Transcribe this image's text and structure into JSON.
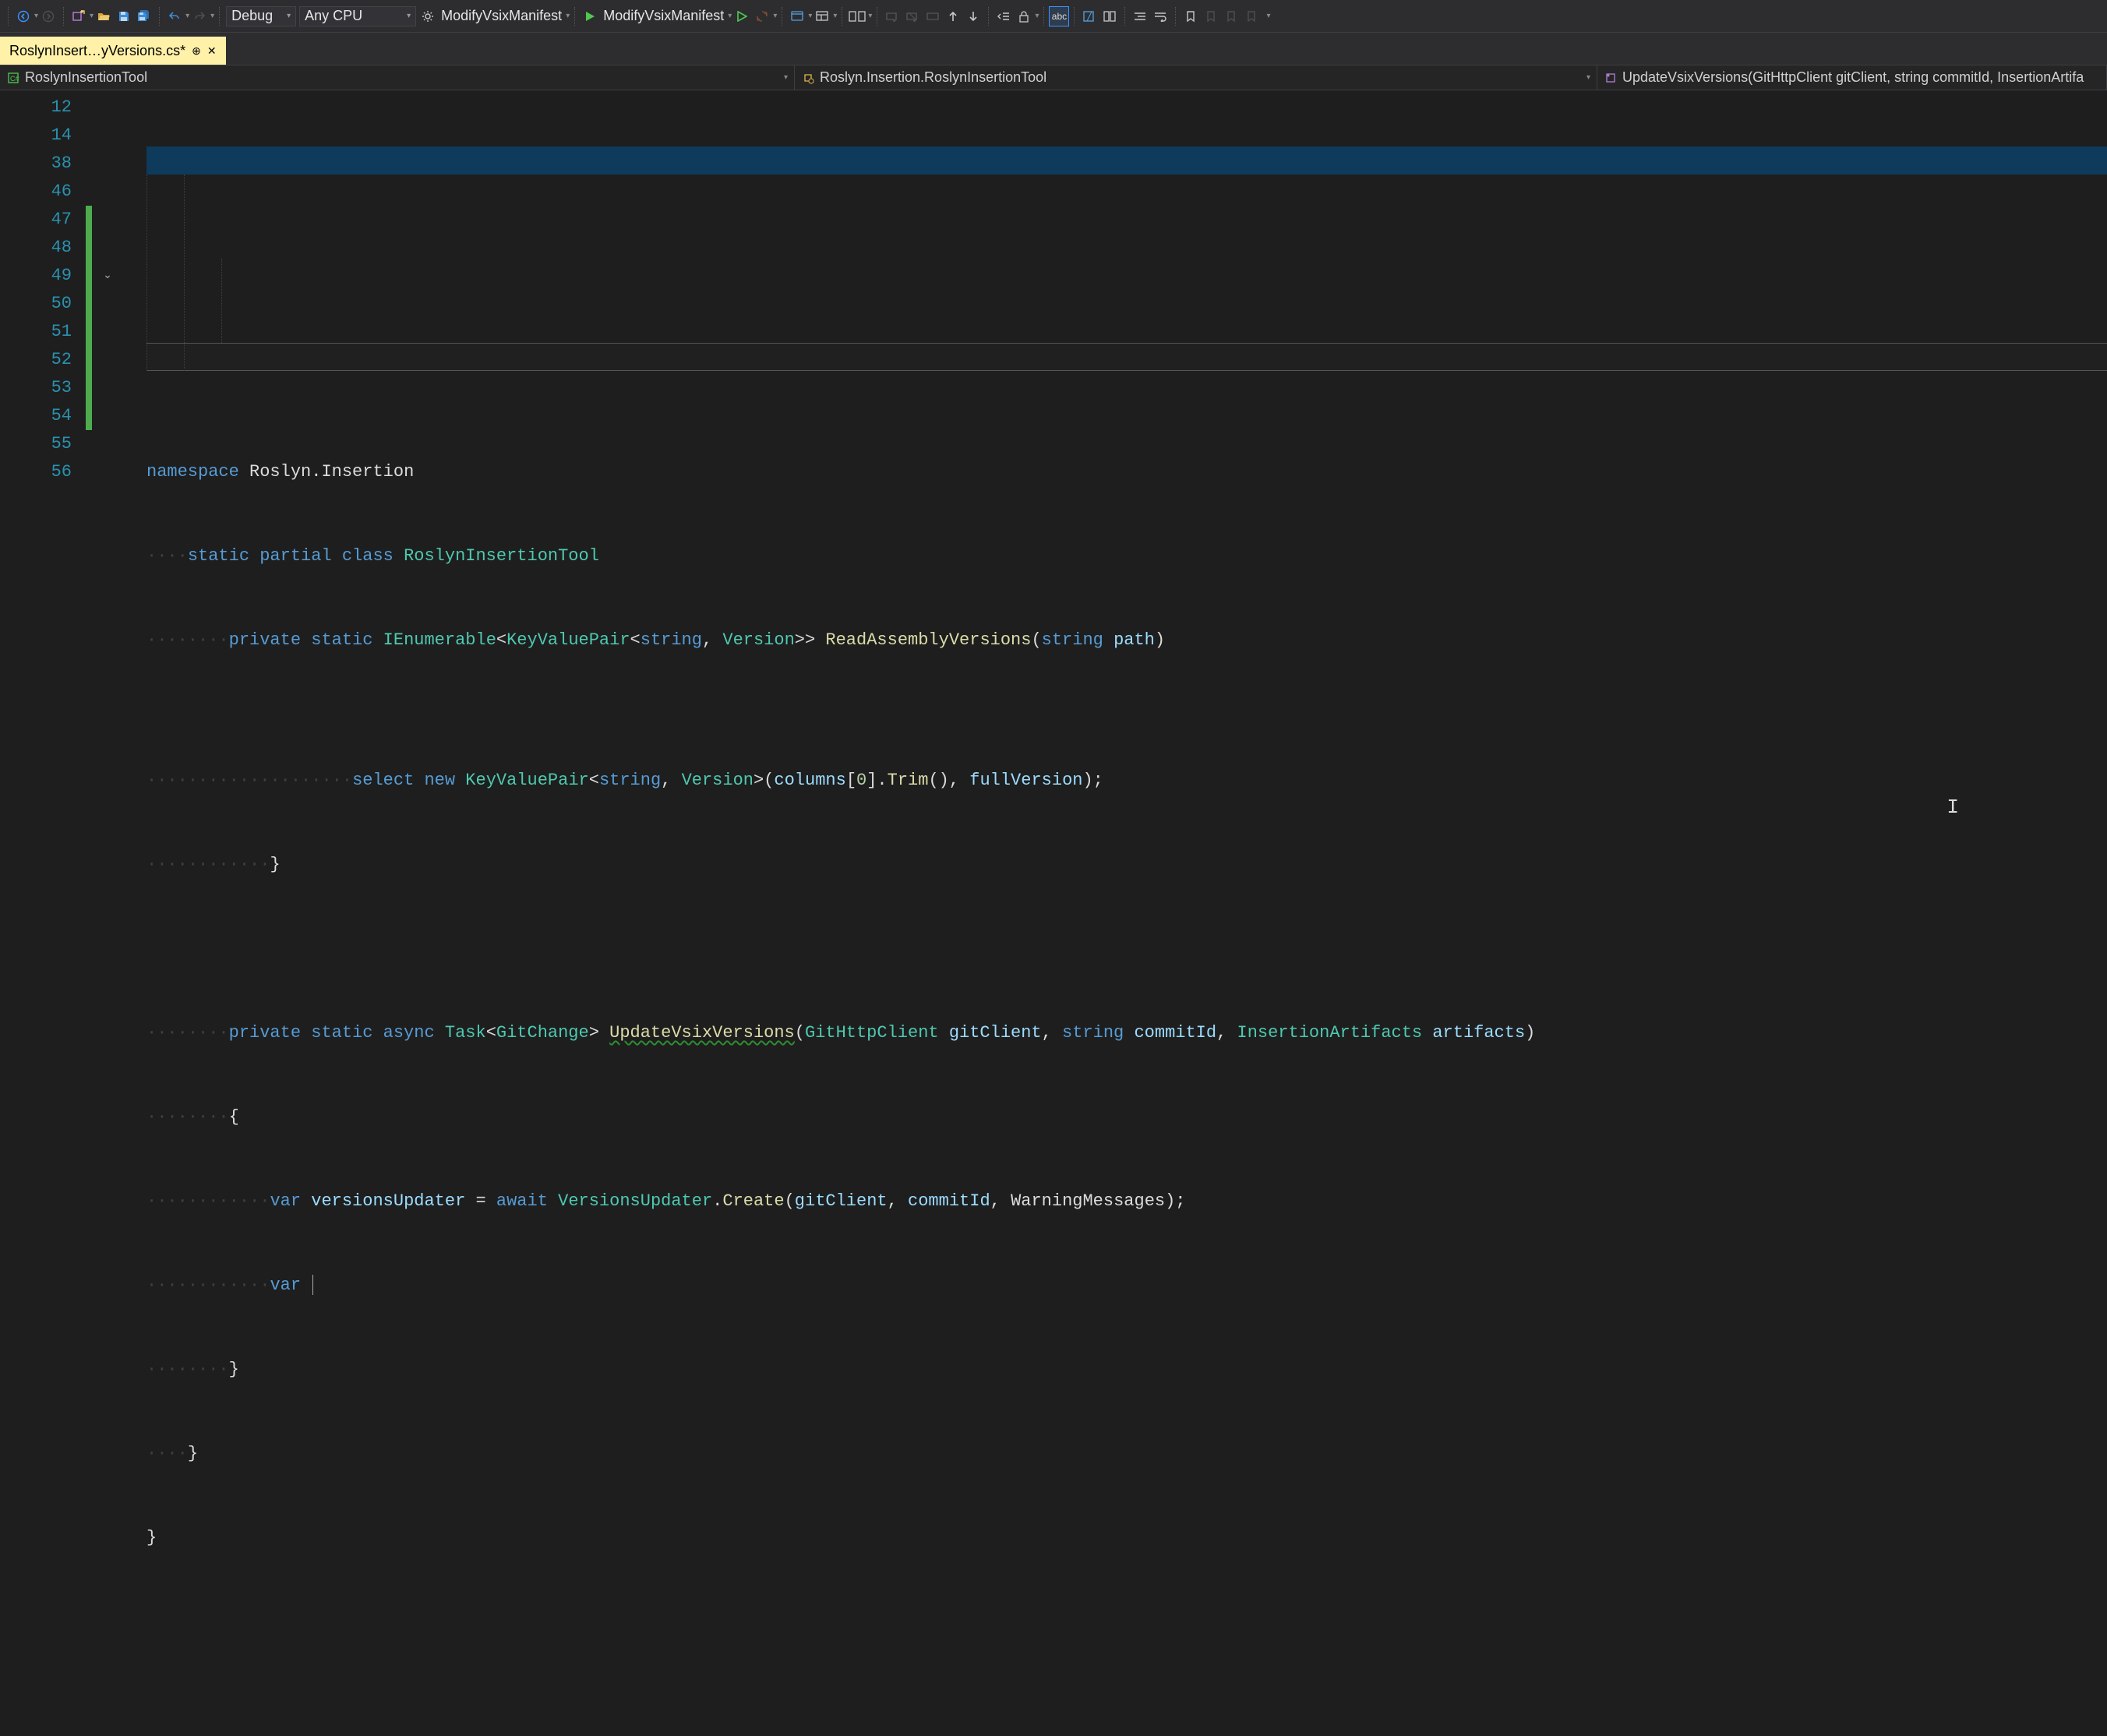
{
  "toolbar": {
    "config_label": "Debug",
    "platform_label": "Any CPU",
    "startup_label1": "ModifyVsixManifest",
    "startup_label2": "ModifyVsixManifest"
  },
  "tab": {
    "name": "RoslynInsert…yVersions.cs*"
  },
  "navbar": {
    "project": "RoslynInsertionTool",
    "type": "Roslyn.Insertion.RoslynInsertionTool",
    "member": "UpdateVsixVersions(GitHttpClient gitClient, string commitId, InsertionArtifa"
  },
  "line_numbers": [
    "12",
    "14",
    "38",
    "46",
    "47",
    "48",
    "49",
    "50",
    "51",
    "52",
    "53",
    "54",
    "55",
    "56"
  ],
  "code": {
    "l12": {
      "ns": "namespace",
      "name": "Roslyn.Insertion"
    },
    "l14": {
      "kws": "static partial class",
      "name": "RoslynInsertionTool"
    },
    "l38": {
      "mods": "private static",
      "ret1": "IEnumerable",
      "ret2": "KeyValuePair",
      "ta1": "string",
      "ta2": "Version",
      "mname": "ReadAssemblyVersions",
      "p1t": "string",
      "p1n": "path"
    },
    "l46": {
      "sel": "select",
      "nw": "new",
      "kvp": "KeyValuePair",
      "ta1": "string",
      "ta2": "Version",
      "col": "columns",
      "idx": "0",
      "trim": "Trim",
      "fv": "fullVersion"
    },
    "l47": {
      "brace": "}"
    },
    "l49": {
      "mods": "private static async",
      "ret1": "Task",
      "ret2": "GitChange",
      "mname": "UpdateVsixVersions",
      "p1t": "GitHttpClient",
      "p1n": "gitClient",
      "p2t": "string",
      "p2n": "commitId",
      "p3t": "InsertionArtifacts",
      "p3n": "artifacts"
    },
    "l50": {
      "brace": "{"
    },
    "l51": {
      "var": "var",
      "vname": "versionsUpdater",
      "aw": "await",
      "cls": "VersionsUpdater",
      "create": "Create",
      "a1": "gitClient",
      "a2": "commitId",
      "a3": "WarningMessages"
    },
    "l52": {
      "var": "var"
    },
    "l53": {
      "brace": "}"
    },
    "l54": {
      "brace": "}"
    },
    "l55": {
      "brace": "}"
    }
  }
}
